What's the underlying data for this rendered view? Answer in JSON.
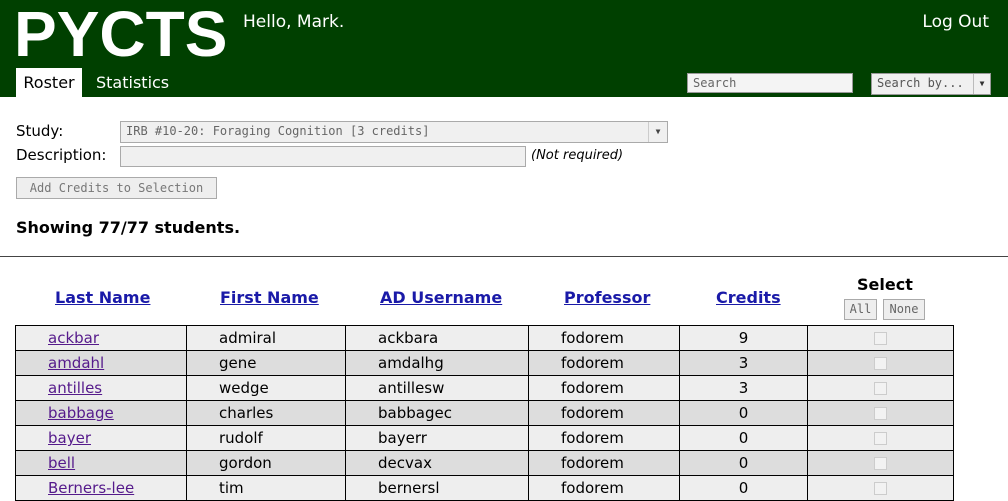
{
  "header": {
    "logo": "PYCTS",
    "greeting": "Hello, Mark.",
    "logout": "Log Out",
    "tabs": [
      {
        "label": "Roster",
        "active": true
      },
      {
        "label": "Statistics",
        "active": false
      }
    ],
    "search": {
      "placeholder": "Search",
      "value": ""
    },
    "search_by": "Search by...",
    "bg_color": "#004000"
  },
  "form": {
    "study_label": "Study:",
    "study_selected": "IRB #10-20: Foraging Cognition [3 credits]",
    "description_label": "Description:",
    "description_value": "",
    "not_required": "(Not required)",
    "add_credits_label": "Add Credits to Selection"
  },
  "showing": "Showing 77/77 students.",
  "table": {
    "headers": {
      "last": "Last Name",
      "first": "First Name",
      "ad": "AD Username",
      "prof": "Professor",
      "credits": "Credits",
      "select": "Select"
    },
    "select_all": "All",
    "select_none": "None",
    "rows": [
      {
        "last": "ackbar",
        "first": "admiral",
        "ad": "ackbara",
        "prof": "fodorem",
        "credits": "9"
      },
      {
        "last": "amdahl",
        "first": "gene",
        "ad": "amdalhg",
        "prof": "fodorem",
        "credits": "3"
      },
      {
        "last": "antilles",
        "first": "wedge",
        "ad": "antillesw",
        "prof": "fodorem",
        "credits": "3"
      },
      {
        "last": "babbage",
        "first": "charles",
        "ad": "babbagec",
        "prof": "fodorem",
        "credits": "0"
      },
      {
        "last": "bayer",
        "first": "rudolf",
        "ad": "bayerr",
        "prof": "fodorem",
        "credits": "0"
      },
      {
        "last": "bell",
        "first": "gordon",
        "ad": "decvax",
        "prof": "fodorem",
        "credits": "0"
      },
      {
        "last": "Berners-lee",
        "first": "tim",
        "ad": "bernersl",
        "prof": "fodorem",
        "credits": "0"
      }
    ]
  }
}
